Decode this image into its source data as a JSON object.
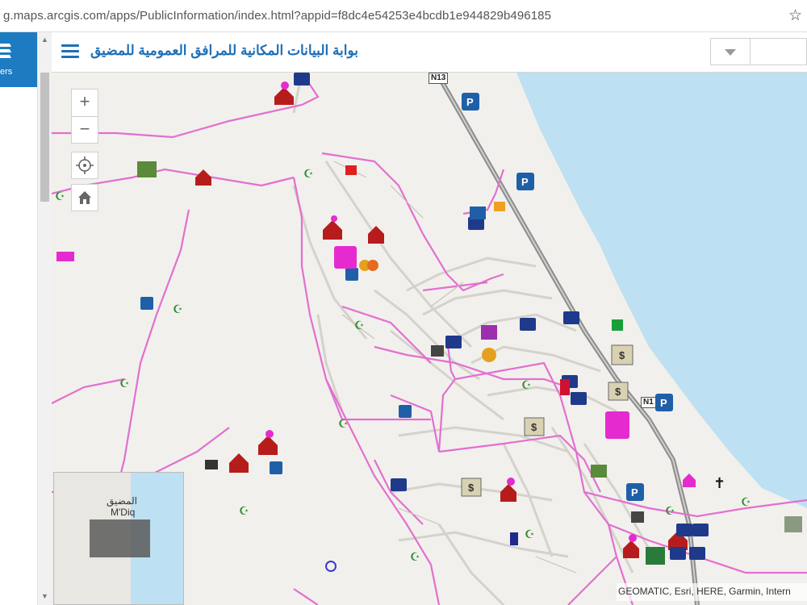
{
  "browser": {
    "url": "g.maps.arcgis.com/apps/PublicInformation/index.html?appid=f8dc4e54253e4bcdb1e944829b496185",
    "bookmark_icon": "star-icon"
  },
  "left_panel": {
    "layers_label": "ers",
    "layers_icon": "layers-icon"
  },
  "header": {
    "title": "بوابة البيانات المكانية للمرافق العمومية للمضيق",
    "menu_icon": "hamburger-menu-icon",
    "dropdown_icon": "chevron-down-icon",
    "accent_color": "#1d6fb8"
  },
  "map_controls": {
    "zoom_in": "+",
    "zoom_out": "−",
    "locate_icon": "locate-icon",
    "home_icon": "home-icon"
  },
  "overview_map": {
    "label_ar": "المضيق",
    "label_en": "M'Diq"
  },
  "map": {
    "road_labels": [
      "N13",
      "N1"
    ],
    "attribution": "GEOMATIC, Esri, HERE, Garmin, Intern",
    "colors": {
      "sea": "#bde0f2",
      "land": "#f2f0ec",
      "boundary": "#e26fd0",
      "highway": "#9a9a9a",
      "parking": "#1f5fa8",
      "school": "#c0392b",
      "mosque": "#2e8b2e"
    }
  }
}
